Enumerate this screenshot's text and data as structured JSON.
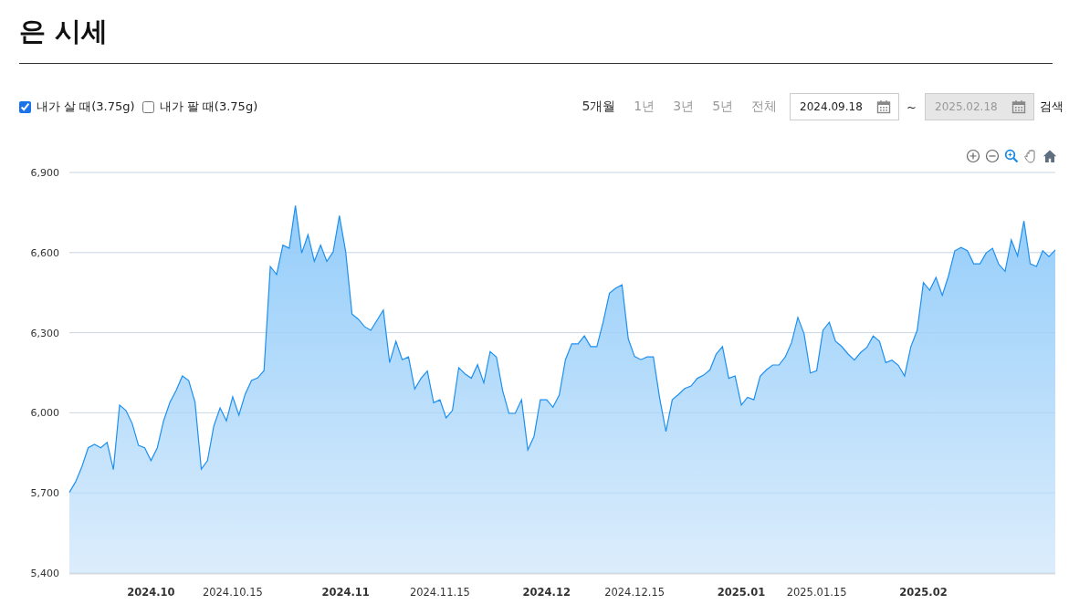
{
  "title": "은 시세",
  "filters": [
    {
      "label": "내가 살 때(3.75g)",
      "checked": true
    },
    {
      "label": "내가 팔 때(3.75g)",
      "checked": false
    }
  ],
  "periods": [
    {
      "label": "5개월",
      "selected": true
    },
    {
      "label": "1년",
      "selected": false
    },
    {
      "label": "3년",
      "selected": false
    },
    {
      "label": "5년",
      "selected": false
    },
    {
      "label": "전체",
      "selected": false
    }
  ],
  "date_from": {
    "value": "2024.09.18",
    "disabled": false
  },
  "separator": "~",
  "date_to": {
    "value": "2025.02.18",
    "disabled": true
  },
  "search_button": "검색",
  "chart": {
    "chart_data": {
      "type": "area",
      "grid": true,
      "categories": [
        null,
        null,
        null,
        null,
        null,
        null,
        null,
        null,
        null,
        null,
        null,
        null,
        null,
        "2024.10",
        null,
        null,
        null,
        null,
        null,
        null,
        null,
        null,
        null,
        null,
        null,
        null,
        "2024.10.15",
        null,
        null,
        null,
        null,
        null,
        null,
        null,
        null,
        null,
        null,
        null,
        null,
        null,
        null,
        null,
        null,
        null,
        "2024.11",
        null,
        null,
        null,
        null,
        null,
        null,
        null,
        null,
        null,
        null,
        null,
        null,
        null,
        null,
        "2024.11.15",
        null,
        null,
        null,
        null,
        null,
        null,
        null,
        null,
        null,
        null,
        null,
        null,
        null,
        null,
        null,
        null,
        "2024.12",
        null,
        null,
        null,
        null,
        null,
        null,
        null,
        null,
        null,
        null,
        null,
        null,
        null,
        "2024.12.15",
        null,
        null,
        null,
        null,
        null,
        null,
        null,
        null,
        null,
        null,
        null,
        null,
        null,
        null,
        null,
        null,
        "2025.01",
        null,
        null,
        null,
        null,
        null,
        null,
        null,
        null,
        null,
        null,
        null,
        "2025.01.15",
        null,
        null,
        null,
        null,
        null,
        null,
        null,
        null,
        null,
        null,
        null,
        null,
        null,
        null,
        null,
        null,
        "2025.02",
        null,
        null,
        null,
        null,
        null,
        null,
        null,
        null,
        null,
        null,
        null,
        null,
        null,
        null,
        null,
        null,
        null,
        null,
        null,
        null,
        null
      ],
      "values": [
        5702,
        5742,
        5799,
        5869,
        5882,
        5869,
        5889,
        5787,
        6029,
        6009,
        5960,
        5878,
        5869,
        5821,
        5869,
        5970,
        6039,
        6083,
        6138,
        6121,
        6040,
        5789,
        5821,
        5950,
        6018,
        5970,
        6060,
        5991,
        6070,
        6121,
        6131,
        6158,
        6548,
        6518,
        6628,
        6616,
        6776,
        6598,
        6667,
        6567,
        6628,
        6567,
        6602,
        6738,
        6602,
        6370,
        6351,
        6323,
        6309,
        6347,
        6385,
        6188,
        6268,
        6199,
        6209,
        6089,
        6129,
        6157,
        6038,
        6049,
        5981,
        6009,
        6169,
        6146,
        6129,
        6180,
        6112,
        6229,
        6209,
        6083,
        5998,
        5998,
        6049,
        5861,
        5912,
        6049,
        6049,
        6021,
        6066,
        6199,
        6258,
        6258,
        6288,
        6248,
        6248,
        6340,
        6448,
        6467,
        6479,
        6277,
        6211,
        6199,
        6209,
        6209,
        6055,
        5930,
        6049,
        6069,
        6091,
        6100,
        6129,
        6141,
        6161,
        6220,
        6248,
        6129,
        6138,
        6029,
        6058,
        6049,
        6137,
        6161,
        6179,
        6179,
        6209,
        6263,
        6357,
        6296,
        6149,
        6158,
        6309,
        6339,
        6268,
        6248,
        6220,
        6197,
        6226,
        6245,
        6288,
        6268,
        6188,
        6197,
        6178,
        6138,
        6248,
        6309,
        6488,
        6459,
        6507,
        6440,
        6514,
        6607,
        6619,
        6607,
        6558,
        6558,
        6599,
        6616,
        6556,
        6530,
        6647,
        6587,
        6719,
        6558,
        6548,
        6607,
        6585,
        6610
      ],
      "ylim": [
        5400,
        6900
      ],
      "yticks": [
        {
          "value": 5400,
          "label": "5,400"
        },
        {
          "value": 5700,
          "label": "5,700"
        },
        {
          "value": 6000,
          "label": "6,000"
        },
        {
          "value": 6300,
          "label": "6,300"
        },
        {
          "value": 6600,
          "label": "6,600"
        },
        {
          "value": 6900,
          "label": "6,900"
        }
      ]
    }
  }
}
